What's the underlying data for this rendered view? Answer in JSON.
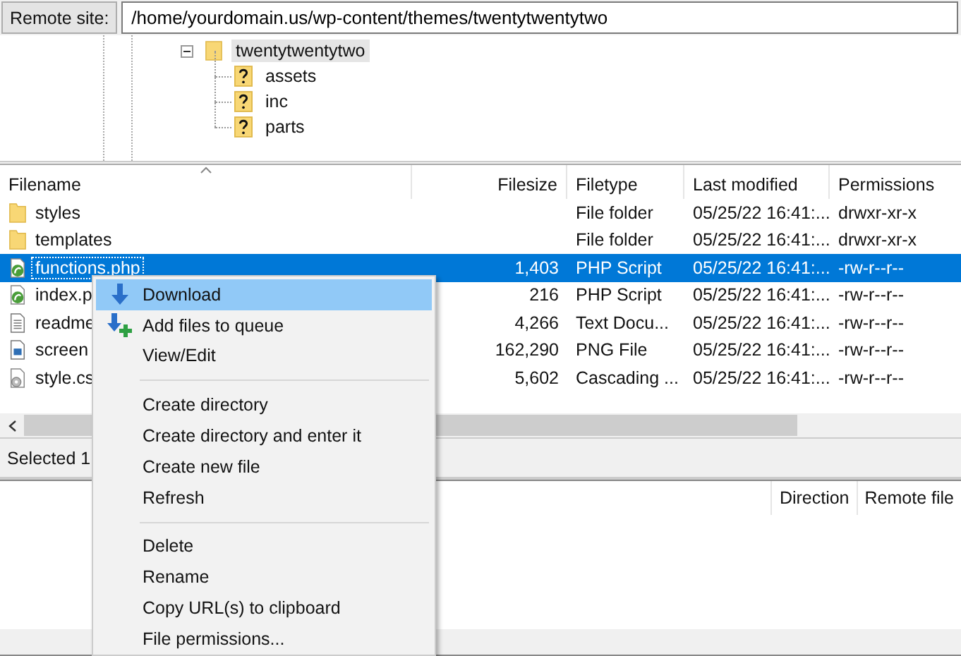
{
  "remote_site": {
    "label": "Remote site:",
    "path": "/home/yourdomain.us/wp-content/themes/twentytwentytwo"
  },
  "tree": [
    {
      "label": "twentytwentytwo",
      "kind": "folder",
      "expanded": true,
      "selected": true,
      "children": [
        {
          "label": "assets",
          "kind": "unknown"
        },
        {
          "label": "inc",
          "kind": "unknown"
        },
        {
          "label": "parts",
          "kind": "unknown"
        }
      ]
    }
  ],
  "file_list": {
    "columns": [
      "Filename",
      "Filesize",
      "Filetype",
      "Last modified",
      "Permissions"
    ],
    "rows": [
      {
        "kind": "folder",
        "name": "styles",
        "size": "",
        "type": "File folder",
        "modified": "05/25/22 16:41:...",
        "permissions": "drwxr-xr-x",
        "selected": false
      },
      {
        "kind": "folder",
        "name": "templates",
        "size": "",
        "type": "File folder",
        "modified": "05/25/22 16:41:...",
        "permissions": "drwxr-xr-x",
        "selected": false
      },
      {
        "kind": "php",
        "name": "functions.php",
        "size": "1,403",
        "type": "PHP Script",
        "modified": "05/25/22 16:41:...",
        "permissions": "-rw-r--r--",
        "selected": true
      },
      {
        "kind": "php",
        "name": "index.p",
        "size": "216",
        "type": "PHP Script",
        "modified": "05/25/22 16:41:...",
        "permissions": "-rw-r--r--",
        "selected": false
      },
      {
        "kind": "text",
        "name": "readme",
        "size": "4,266",
        "type": "Text Docu...",
        "modified": "05/25/22 16:41:...",
        "permissions": "-rw-r--r--",
        "selected": false
      },
      {
        "kind": "image",
        "name": "screen",
        "size": "162,290",
        "type": "PNG File",
        "modified": "05/25/22 16:41:...",
        "permissions": "-rw-r--r--",
        "selected": false
      },
      {
        "kind": "css",
        "name": "style.cs",
        "size": "5,602",
        "type": "Cascading ...",
        "modified": "05/25/22 16:41:...",
        "permissions": "-rw-r--r--",
        "selected": false
      }
    ]
  },
  "status_bar": "Selected 1",
  "queue": {
    "columns": [
      "Direction",
      "Remote file"
    ]
  },
  "context_menu": [
    {
      "kind": "download",
      "label": "Download",
      "selected": true
    },
    {
      "kind": "queue",
      "label": "Add files to queue",
      "selected": false
    },
    {
      "kind": "item",
      "label": "View/Edit",
      "selected": false
    },
    {
      "kind": "separator"
    },
    {
      "kind": "item",
      "label": "Create directory",
      "selected": false
    },
    {
      "kind": "item",
      "label": "Create directory and enter it",
      "selected": false
    },
    {
      "kind": "item",
      "label": "Create new file",
      "selected": false
    },
    {
      "kind": "item",
      "label": "Refresh",
      "selected": false
    },
    {
      "kind": "separator"
    },
    {
      "kind": "item",
      "label": "Delete",
      "selected": false
    },
    {
      "kind": "item",
      "label": "Rename",
      "selected": false
    },
    {
      "kind": "item",
      "label": "Copy URL(s) to clipboard",
      "selected": false
    },
    {
      "kind": "item",
      "label": "File permissions...",
      "selected": false
    }
  ]
}
